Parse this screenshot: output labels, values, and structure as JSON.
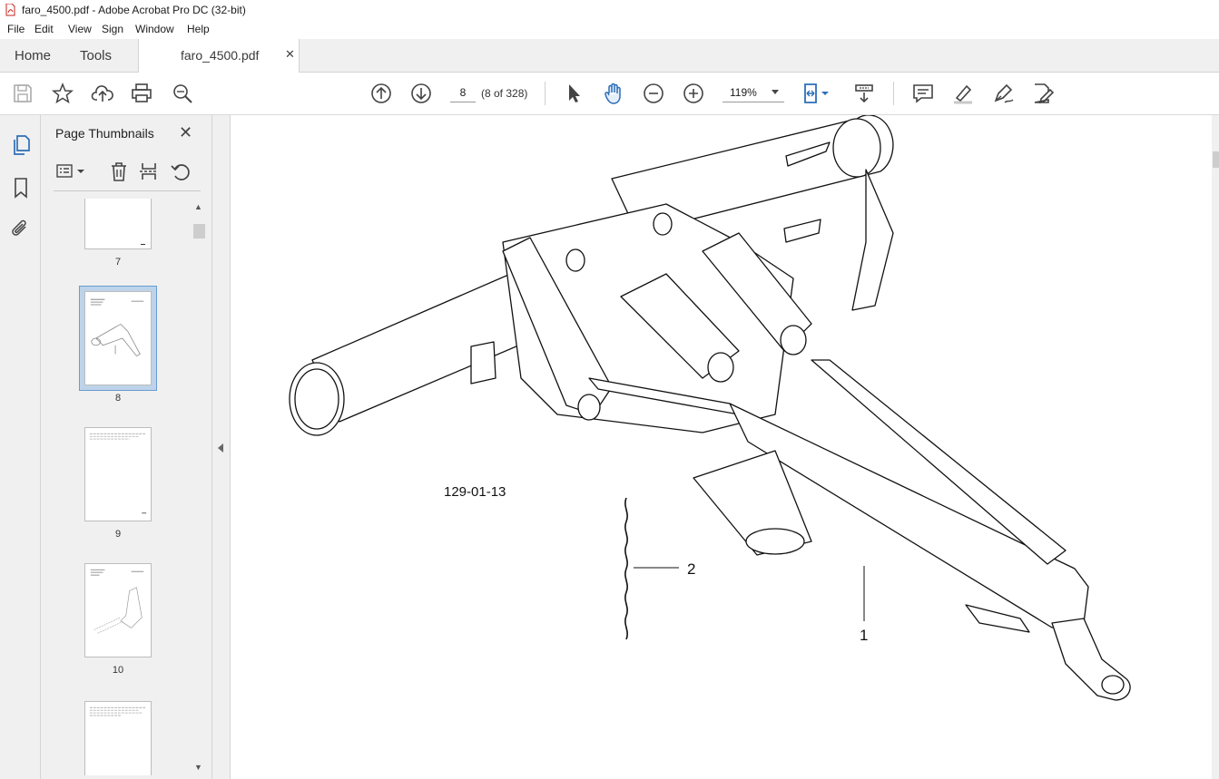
{
  "window": {
    "title": "faro_4500.pdf - Adobe Acrobat Pro DC (32-bit)"
  },
  "menu": [
    "File",
    "Edit",
    "View",
    "Sign",
    "Window",
    "Help"
  ],
  "tabs": {
    "home": "Home",
    "tools": "Tools",
    "document": "faro_4500.pdf"
  },
  "toolbar": {
    "page_number": "8",
    "page_count": "(8 of 328)",
    "zoom": "119%"
  },
  "panel": {
    "title": "Page Thumbnails",
    "thumbnails": [
      {
        "page": "7"
      },
      {
        "page": "8",
        "selected": true
      },
      {
        "page": "9"
      },
      {
        "page": "10"
      }
    ]
  },
  "drawing": {
    "part_number": "129-01-13",
    "callouts": [
      "1",
      "2"
    ]
  },
  "colors": {
    "accent": "#2d6fb7",
    "panel_bg": "#f0f0f0",
    "selected_thumb": "#bcd3ea"
  }
}
